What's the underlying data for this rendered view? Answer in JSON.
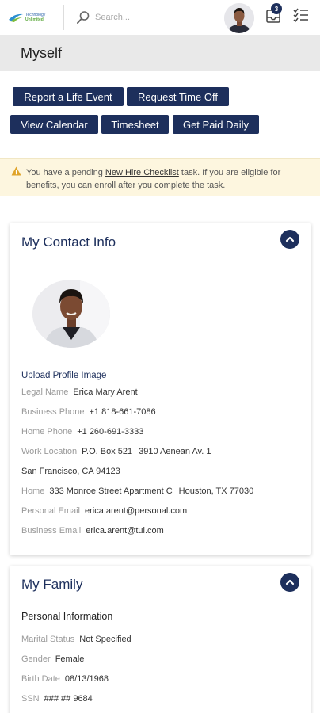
{
  "header": {
    "logo_line1": "Technology",
    "logo_line2": "Unlimited",
    "search_placeholder": "Search...",
    "notification_count": "3"
  },
  "page_title": "Myself",
  "actions": [
    "Report a Life Event",
    "Request Time Off",
    "View Calendar",
    "Timesheet",
    "Get Paid Daily"
  ],
  "alert": {
    "prefix": "You have a pending ",
    "link": "New Hire Checklist",
    "suffix": " task. If you are eligible for benefits, you can enroll after you complete the task."
  },
  "contact": {
    "title": "My Contact Info",
    "upload_label": "Upload Profile Image",
    "legal_name_label": "Legal Name",
    "legal_name": "Erica Mary Arent",
    "business_phone_label": "Business Phone",
    "business_phone": "+1 818-661-7086",
    "home_phone_label": "Home Phone",
    "home_phone": "+1 260-691-3333",
    "work_location_label": "Work Location",
    "work_location_line1": "P.O. Box 521",
    "work_location_line2": "3910 Aenean Av. 1",
    "work_location_line3": "San Francisco, CA 94123",
    "home_label": "Home",
    "home_line1": "333 Monroe Street Apartment C",
    "home_line2": "Houston, TX 77030",
    "personal_email_label": "Personal Email",
    "personal_email": "erica.arent@personal.com",
    "business_email_label": "Business Email",
    "business_email": "erica.arent@tul.com"
  },
  "family": {
    "title": "My Family",
    "section": "Personal Information",
    "marital_label": "Marital Status",
    "marital": "Not Specified",
    "gender_label": "Gender",
    "gender": "Female",
    "birth_label": "Birth Date",
    "birth": "08/13/1968",
    "ssn_label": "SSN",
    "ssn": "### ## 9684"
  },
  "colors": {
    "primary": "#1d2f5c",
    "alert_bg": "#fdf6df",
    "alert_icon": "#e0a42a",
    "title_bar": "#e9e9e9"
  }
}
